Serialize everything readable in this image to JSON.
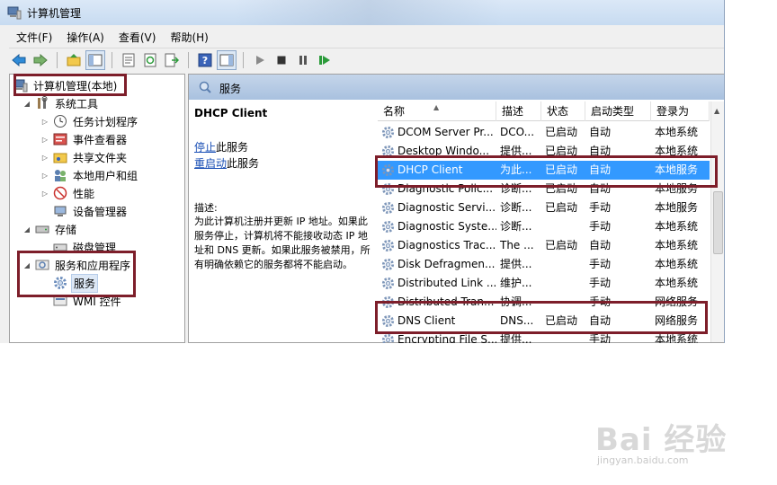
{
  "window": {
    "title": "计算机管理"
  },
  "menu": [
    "文件(F)",
    "操作(A)",
    "查看(V)",
    "帮助(H)"
  ],
  "tree": {
    "root": "计算机管理(本地)",
    "system_tools": "系统工具",
    "task_scheduler": "任务计划程序",
    "event_viewer": "事件查看器",
    "shared_folders": "共享文件夹",
    "local_users": "本地用户和组",
    "performance": "性能",
    "device_manager": "设备管理器",
    "storage": "存储",
    "disk_management": "磁盘管理",
    "services_apps": "服务和应用程序",
    "services": "服务",
    "wmi": "WMI 控件"
  },
  "pane": {
    "header": "服务",
    "selected_service": "DHCP Client",
    "stop_link": "停止",
    "stop_suffix": "此服务",
    "restart_link": "重启动",
    "restart_suffix": "此服务",
    "desc_label": "描述:",
    "desc_text": "为此计算机注册并更新 IP 地址。如果此服务停止，计算机将不能接收动态 IP 地址和 DNS 更新。如果此服务被禁用，所有明确依赖它的服务都将不能启动。"
  },
  "columns": [
    "名称",
    "描述",
    "状态",
    "启动类型",
    "登录为"
  ],
  "services": [
    {
      "name": "DCOM Server Pr...",
      "desc": "DCO...",
      "status": "已启动",
      "startup": "自动",
      "logon": "本地系统"
    },
    {
      "name": "Desktop Windo...",
      "desc": "提供...",
      "status": "已启动",
      "startup": "自动",
      "logon": "本地系统"
    },
    {
      "name": "DHCP Client",
      "desc": "为此...",
      "status": "已启动",
      "startup": "自动",
      "logon": "本地服务"
    },
    {
      "name": "Diagnostic Polic...",
      "desc": "诊断...",
      "status": "已启动",
      "startup": "自动",
      "logon": "本地服务"
    },
    {
      "name": "Diagnostic Servi...",
      "desc": "诊断...",
      "status": "已启动",
      "startup": "手动",
      "logon": "本地服务"
    },
    {
      "name": "Diagnostic Syste...",
      "desc": "诊断...",
      "status": "",
      "startup": "手动",
      "logon": "本地系统"
    },
    {
      "name": "Diagnostics Trac...",
      "desc": "The ...",
      "status": "已启动",
      "startup": "自动",
      "logon": "本地系统"
    },
    {
      "name": "Disk Defragmen...",
      "desc": "提供...",
      "status": "",
      "startup": "手动",
      "logon": "本地系统"
    },
    {
      "name": "Distributed Link ...",
      "desc": "维护...",
      "status": "",
      "startup": "手动",
      "logon": "本地系统"
    },
    {
      "name": "Distributed Tran...",
      "desc": "协调...",
      "status": "",
      "startup": "手动",
      "logon": "网络服务"
    },
    {
      "name": "DNS Client",
      "desc": "DNS...",
      "status": "已启动",
      "startup": "自动",
      "logon": "网络服务"
    },
    {
      "name": "Encrypting File S...",
      "desc": "提供...",
      "status": "",
      "startup": "手动",
      "logon": "本地系统"
    }
  ],
  "watermark": {
    "brand": "Bai 经验",
    "url": "jingyan.baidu.com"
  }
}
